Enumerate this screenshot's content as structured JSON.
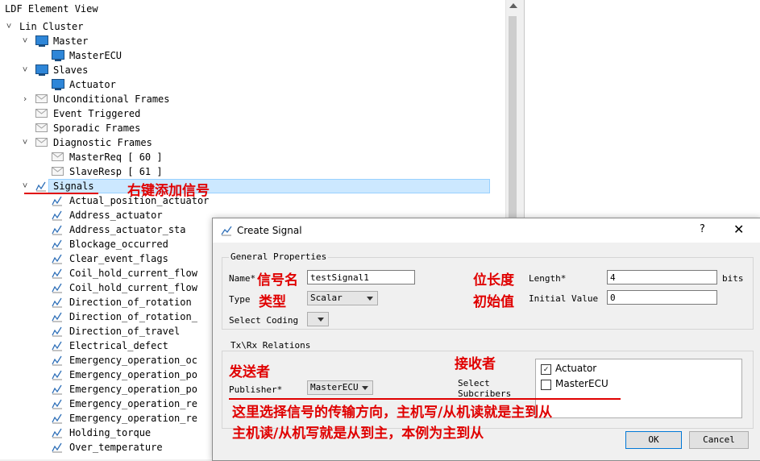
{
  "tree": {
    "title": "LDF Element View",
    "nodes": [
      {
        "label": "Lin Cluster",
        "expander": "˅",
        "icon": "none"
      },
      {
        "label": "Master",
        "expander": "˅",
        "icon": "monitor"
      },
      {
        "label": "MasterECU",
        "expander": "",
        "icon": "monitor"
      },
      {
        "label": "Slaves",
        "expander": "˅",
        "icon": "monitor"
      },
      {
        "label": "Actuator",
        "expander": "",
        "icon": "monitor"
      },
      {
        "label": "Unconditional Frames",
        "expander": "›",
        "icon": "envelope"
      },
      {
        "label": "Event Triggered",
        "expander": "",
        "icon": "envelope"
      },
      {
        "label": "Sporadic Frames",
        "expander": "",
        "icon": "envelope"
      },
      {
        "label": "Diagnostic Frames",
        "expander": "˅",
        "icon": "envelope"
      },
      {
        "label": "MasterReq [ 60 ]",
        "expander": "",
        "icon": "envelope"
      },
      {
        "label": "SlaveResp [ 61 ]",
        "expander": "",
        "icon": "envelope"
      },
      {
        "label": "Signals",
        "expander": "˅",
        "icon": "signal"
      },
      {
        "label": "Actual_position_actuator",
        "expander": "",
        "icon": "signal"
      },
      {
        "label": "Address_actuator",
        "expander": "",
        "icon": "signal"
      },
      {
        "label": "Address_actuator_sta",
        "expander": "",
        "icon": "signal"
      },
      {
        "label": "Blockage_occurred",
        "expander": "",
        "icon": "signal"
      },
      {
        "label": "Clear_event_flags",
        "expander": "",
        "icon": "signal"
      },
      {
        "label": "Coil_hold_current_flow",
        "expander": "",
        "icon": "signal"
      },
      {
        "label": "Coil_hold_current_flow",
        "expander": "",
        "icon": "signal"
      },
      {
        "label": "Direction_of_rotation",
        "expander": "",
        "icon": "signal"
      },
      {
        "label": "Direction_of_rotation_",
        "expander": "",
        "icon": "signal"
      },
      {
        "label": "Direction_of_travel",
        "expander": "",
        "icon": "signal"
      },
      {
        "label": "Electrical_defect",
        "expander": "",
        "icon": "signal"
      },
      {
        "label": "Emergency_operation_oc",
        "expander": "",
        "icon": "signal"
      },
      {
        "label": "Emergency_operation_po",
        "expander": "",
        "icon": "signal"
      },
      {
        "label": "Emergency_operation_po",
        "expander": "",
        "icon": "signal"
      },
      {
        "label": "Emergency_operation_re",
        "expander": "",
        "icon": "signal"
      },
      {
        "label": "Emergency_operation_re",
        "expander": "",
        "icon": "signal"
      },
      {
        "label": "Holding_torque",
        "expander": "",
        "icon": "signal"
      },
      {
        "label": "Over_temperature",
        "expander": "",
        "icon": "signal"
      }
    ],
    "selected": "Signals"
  },
  "annotations": {
    "right_click": "右键添加信号",
    "signal_name": "信号名",
    "type": "类型",
    "bit_length": "位长度",
    "initial_value": "初始值",
    "sender": "发送者",
    "receiver": "接收者",
    "note_line1": "这里选择信号的传输方向，主机写/从机读就是主到从",
    "note_line2": "主机读/从机写就是从到主，本例为主到从"
  },
  "dialog": {
    "title": "Create Signal",
    "help": "?",
    "close": "✕",
    "general": {
      "title": "General Properties",
      "name_label": "Name*",
      "name_value": "testSignal1",
      "type_label": "Type",
      "type_value": "Scalar",
      "coding_label": "Select Coding",
      "length_label": "Length*",
      "length_value": "4",
      "bits": "bits",
      "init_label": "Initial Value",
      "init_value": "0"
    },
    "txrx": {
      "title": "Tx\\Rx Relations",
      "publisher_label": "Publisher*",
      "publisher_value": "MasterECU",
      "subscribers_label1": "Select",
      "subscribers_label2": "Subcribers",
      "subscribers": [
        {
          "name": "Actuator",
          "checked": true
        },
        {
          "name": "MasterECU",
          "checked": false
        }
      ]
    },
    "ok": "OK",
    "cancel": "Cancel"
  },
  "colors": {
    "annotation": "#e00000",
    "selection": "#cce8ff",
    "monitor": "#2e86d8"
  }
}
